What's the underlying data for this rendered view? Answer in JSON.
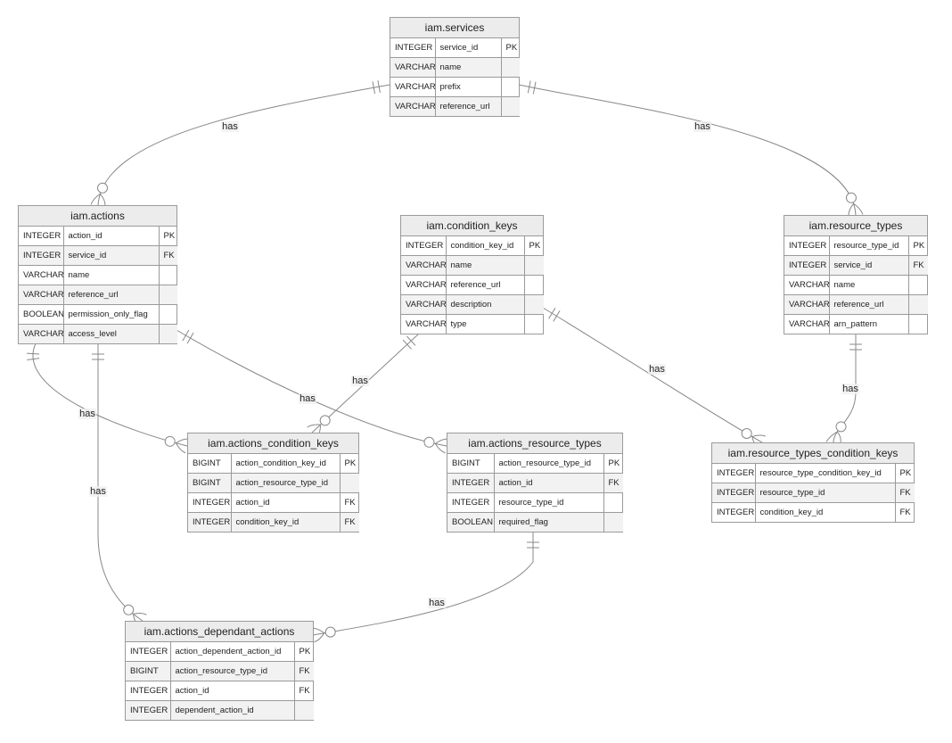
{
  "colors": {
    "header": "#ececec",
    "row_alt": "#f2f2f2",
    "border": "#9a9a9a",
    "edge": "#888888"
  },
  "entities": {
    "services": {
      "title": "iam.services",
      "rows": [
        [
          "INTEGER",
          "service_id",
          "PK"
        ],
        [
          "VARCHAR",
          "name",
          ""
        ],
        [
          "VARCHAR",
          "prefix",
          ""
        ],
        [
          "VARCHAR",
          "reference_url",
          ""
        ]
      ]
    },
    "actions": {
      "title": "iam.actions",
      "rows": [
        [
          "INTEGER",
          "action_id",
          "PK"
        ],
        [
          "INTEGER",
          "service_id",
          "FK"
        ],
        [
          "VARCHAR",
          "name",
          ""
        ],
        [
          "VARCHAR",
          "reference_url",
          ""
        ],
        [
          "BOOLEAN",
          "permission_only_flag",
          ""
        ],
        [
          "VARCHAR",
          "access_level",
          ""
        ]
      ]
    },
    "condition_keys": {
      "title": "iam.condition_keys",
      "rows": [
        [
          "INTEGER",
          "condition_key_id",
          "PK"
        ],
        [
          "VARCHAR",
          "name",
          ""
        ],
        [
          "VARCHAR",
          "reference_url",
          ""
        ],
        [
          "VARCHAR",
          "description",
          ""
        ],
        [
          "VARCHAR",
          "type",
          ""
        ]
      ]
    },
    "resource_types": {
      "title": "iam.resource_types",
      "rows": [
        [
          "INTEGER",
          "resource_type_id",
          "PK"
        ],
        [
          "INTEGER",
          "service_id",
          "FK"
        ],
        [
          "VARCHAR",
          "name",
          ""
        ],
        [
          "VARCHAR",
          "reference_url",
          ""
        ],
        [
          "VARCHAR",
          "arn_pattern",
          ""
        ]
      ]
    },
    "actions_condition_keys": {
      "title": "iam.actions_condition_keys",
      "rows": [
        [
          "BIGINT",
          "action_condition_key_id",
          "PK"
        ],
        [
          "BIGINT",
          "action_resource_type_id",
          ""
        ],
        [
          "INTEGER",
          "action_id",
          "FK"
        ],
        [
          "INTEGER",
          "condition_key_id",
          "FK"
        ]
      ]
    },
    "actions_resource_types": {
      "title": "iam.actions_resource_types",
      "rows": [
        [
          "BIGINT",
          "action_resource_type_id",
          "PK"
        ],
        [
          "INTEGER",
          "action_id",
          "FK"
        ],
        [
          "INTEGER",
          "resource_type_id",
          ""
        ],
        [
          "BOOLEAN",
          "required_flag",
          ""
        ]
      ]
    },
    "resource_types_condition_keys": {
      "title": "iam.resource_types_condition_keys",
      "rows": [
        [
          "INTEGER",
          "resource_type_condition_key_id",
          "PK"
        ],
        [
          "INTEGER",
          "resource_type_id",
          "FK"
        ],
        [
          "INTEGER",
          "condition_key_id",
          "FK"
        ]
      ]
    },
    "actions_dependant_actions": {
      "title": "iam.actions_dependant_actions",
      "rows": [
        [
          "INTEGER",
          "action_dependent_action_id",
          "PK"
        ],
        [
          "BIGINT",
          "action_resource_type_id",
          "FK"
        ],
        [
          "INTEGER",
          "action_id",
          "FK"
        ],
        [
          "INTEGER",
          "dependent_action_id",
          ""
        ]
      ]
    }
  },
  "relationships": [
    {
      "from": "iam.services",
      "to": "iam.actions",
      "label": "has",
      "cardinality": "one-to-zero-or-many"
    },
    {
      "from": "iam.services",
      "to": "iam.resource_types",
      "label": "has",
      "cardinality": "one-to-zero-or-many"
    },
    {
      "from": "iam.actions",
      "to": "iam.actions_condition_keys",
      "label": "has",
      "cardinality": "one-to-zero-or-many"
    },
    {
      "from": "iam.actions",
      "to": "iam.actions_dependant_actions",
      "label": "has",
      "cardinality": "one-to-zero-or-many"
    },
    {
      "from": "iam.actions",
      "to": "iam.actions_resource_types",
      "label": "has",
      "cardinality": "one-to-zero-or-many"
    },
    {
      "from": "iam.condition_keys",
      "to": "iam.actions_condition_keys",
      "label": "has",
      "cardinality": "one-to-zero-or-many"
    },
    {
      "from": "iam.condition_keys",
      "to": "iam.resource_types_condition_keys",
      "label": "has",
      "cardinality": "one-to-zero-or-many"
    },
    {
      "from": "iam.resource_types",
      "to": "iam.resource_types_condition_keys",
      "label": "has",
      "cardinality": "one-to-zero-or-many"
    },
    {
      "from": "iam.actions_resource_types",
      "to": "iam.actions_dependant_actions",
      "label": "has",
      "cardinality": "one-to-zero-or-many"
    }
  ]
}
